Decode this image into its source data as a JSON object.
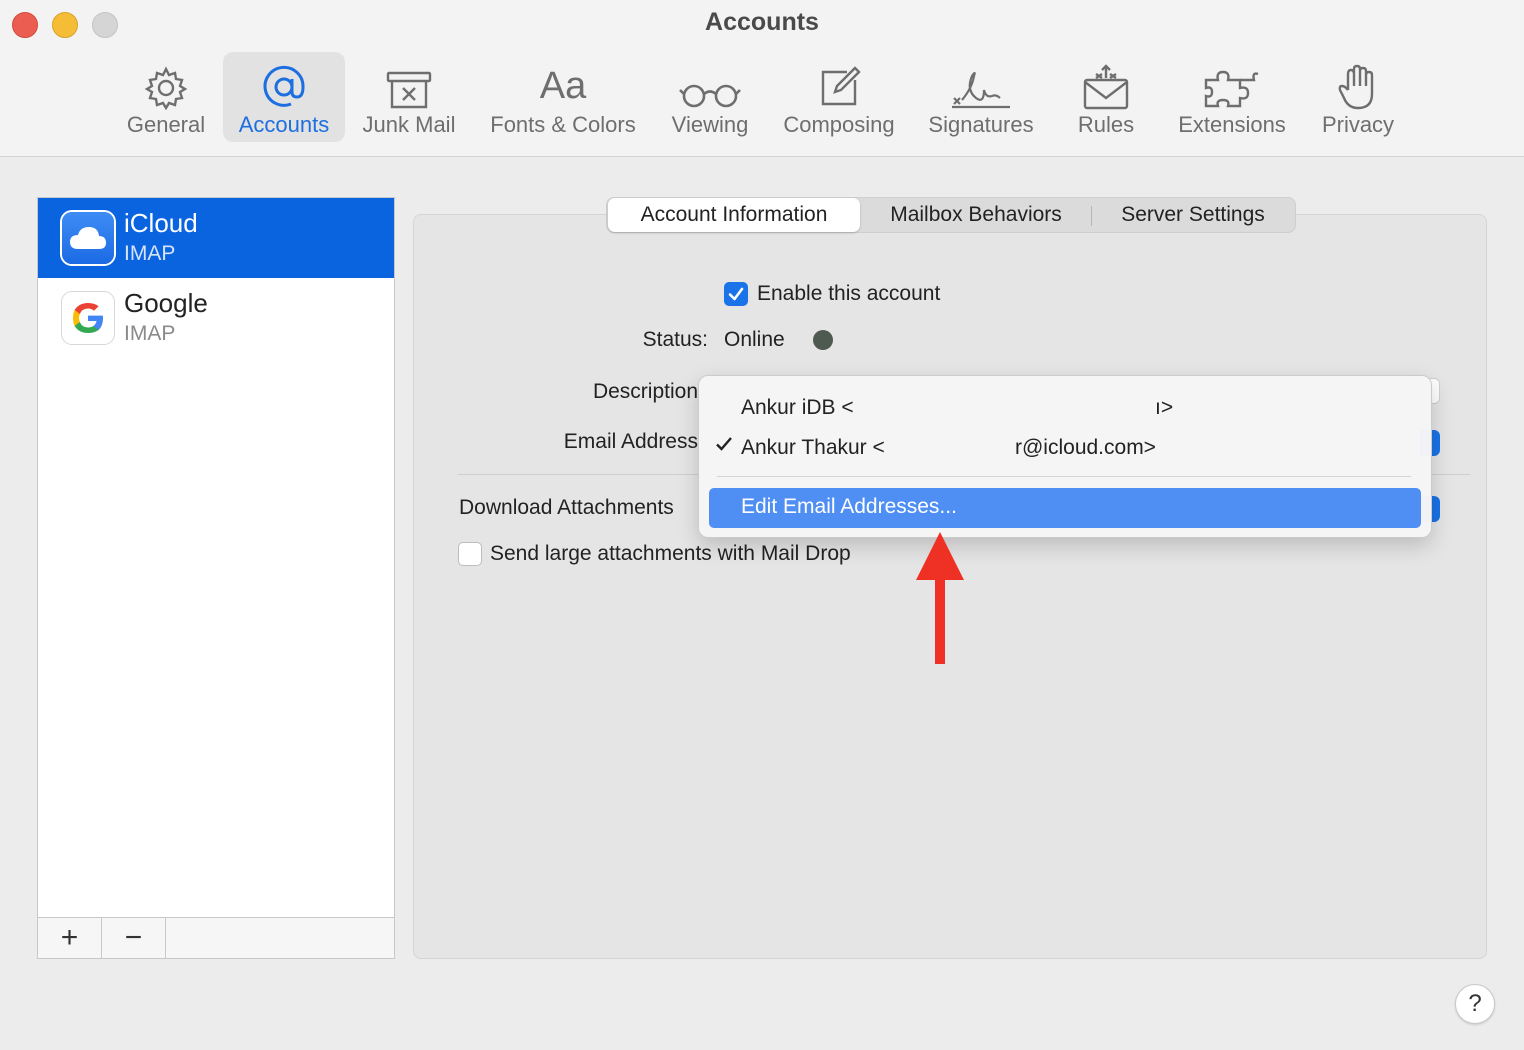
{
  "window": {
    "title": "Accounts",
    "controls": [
      "close",
      "minimize",
      "zoom"
    ]
  },
  "toolbar": {
    "items": [
      {
        "label": "General",
        "icon": "gear-icon"
      },
      {
        "label": "Accounts",
        "icon": "at-sign-icon",
        "active": true
      },
      {
        "label": "Junk Mail",
        "icon": "junk-bin-icon"
      },
      {
        "label": "Fonts & Colors",
        "icon": "font-aa-icon"
      },
      {
        "label": "Viewing",
        "icon": "glasses-icon"
      },
      {
        "label": "Composing",
        "icon": "compose-icon"
      },
      {
        "label": "Signatures",
        "icon": "signature-icon"
      },
      {
        "label": "Rules",
        "icon": "envelope-rules-icon"
      },
      {
        "label": "Extensions",
        "icon": "puzzle-icon"
      },
      {
        "label": "Privacy",
        "icon": "hand-icon"
      }
    ]
  },
  "accounts": [
    {
      "name": "iCloud",
      "type": "IMAP",
      "selected": true,
      "icon": "icloud-icon"
    },
    {
      "name": "Google",
      "type": "IMAP",
      "selected": false,
      "icon": "google-icon"
    }
  ],
  "list_footer": {
    "add": "+",
    "remove": "−"
  },
  "tabs": [
    {
      "label": "Account Information",
      "active": true
    },
    {
      "label": "Mailbox Behaviors",
      "active": false
    },
    {
      "label": "Server Settings",
      "active": false
    }
  ],
  "form": {
    "enable_label": "Enable this account",
    "enable_checked": true,
    "status_label": "Status:",
    "status_value": "Online",
    "status_color": "#4e5a4f",
    "description_label": "Description",
    "email_label": "Email Address",
    "download_label": "Download Attachments",
    "mail_drop_label": "Send large attachments with Mail Drop",
    "mail_drop_checked": false
  },
  "dropdown": {
    "items": [
      {
        "label": "Ankur iDB <",
        "suffix": "ı>",
        "checked": false
      },
      {
        "label": "Ankur Thakur <",
        "suffix": "r@icloud.com>",
        "checked": true
      }
    ],
    "action": "Edit Email Addresses...",
    "highlight_color": "#4f8ff3"
  },
  "help": {
    "label": "?"
  },
  "colors": {
    "accent": "#0a64e0",
    "arrow": "#ee3124"
  }
}
